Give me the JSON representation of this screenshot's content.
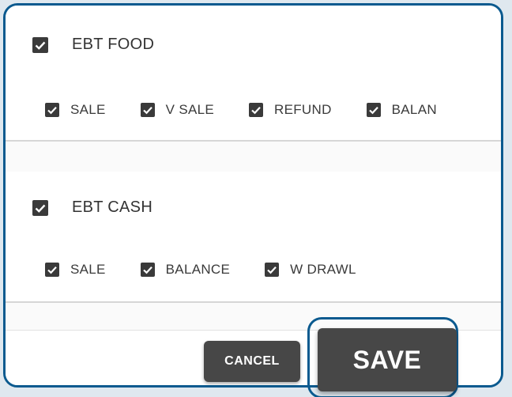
{
  "colors": {
    "accent_border": "#0b5a8f",
    "checkbox_fill": "#3a3a3a",
    "button_fill": "#474747",
    "button_text": "#ffffff"
  },
  "ebt_food": {
    "label": "EBT FOOD",
    "checked": true,
    "options": [
      {
        "label": "SALE",
        "checked": true
      },
      {
        "label": "V SALE",
        "checked": true
      },
      {
        "label": "REFUND",
        "checked": true
      },
      {
        "label": "BALAN",
        "checked": true
      }
    ]
  },
  "ebt_cash": {
    "label": "EBT CASH",
    "checked": true,
    "options": [
      {
        "label": "SALE",
        "checked": true
      },
      {
        "label": "BALANCE",
        "checked": true
      },
      {
        "label": "W DRAWL",
        "checked": true
      }
    ]
  },
  "footer": {
    "cancel_label": "CANCEL",
    "save_label": "SAVE"
  }
}
